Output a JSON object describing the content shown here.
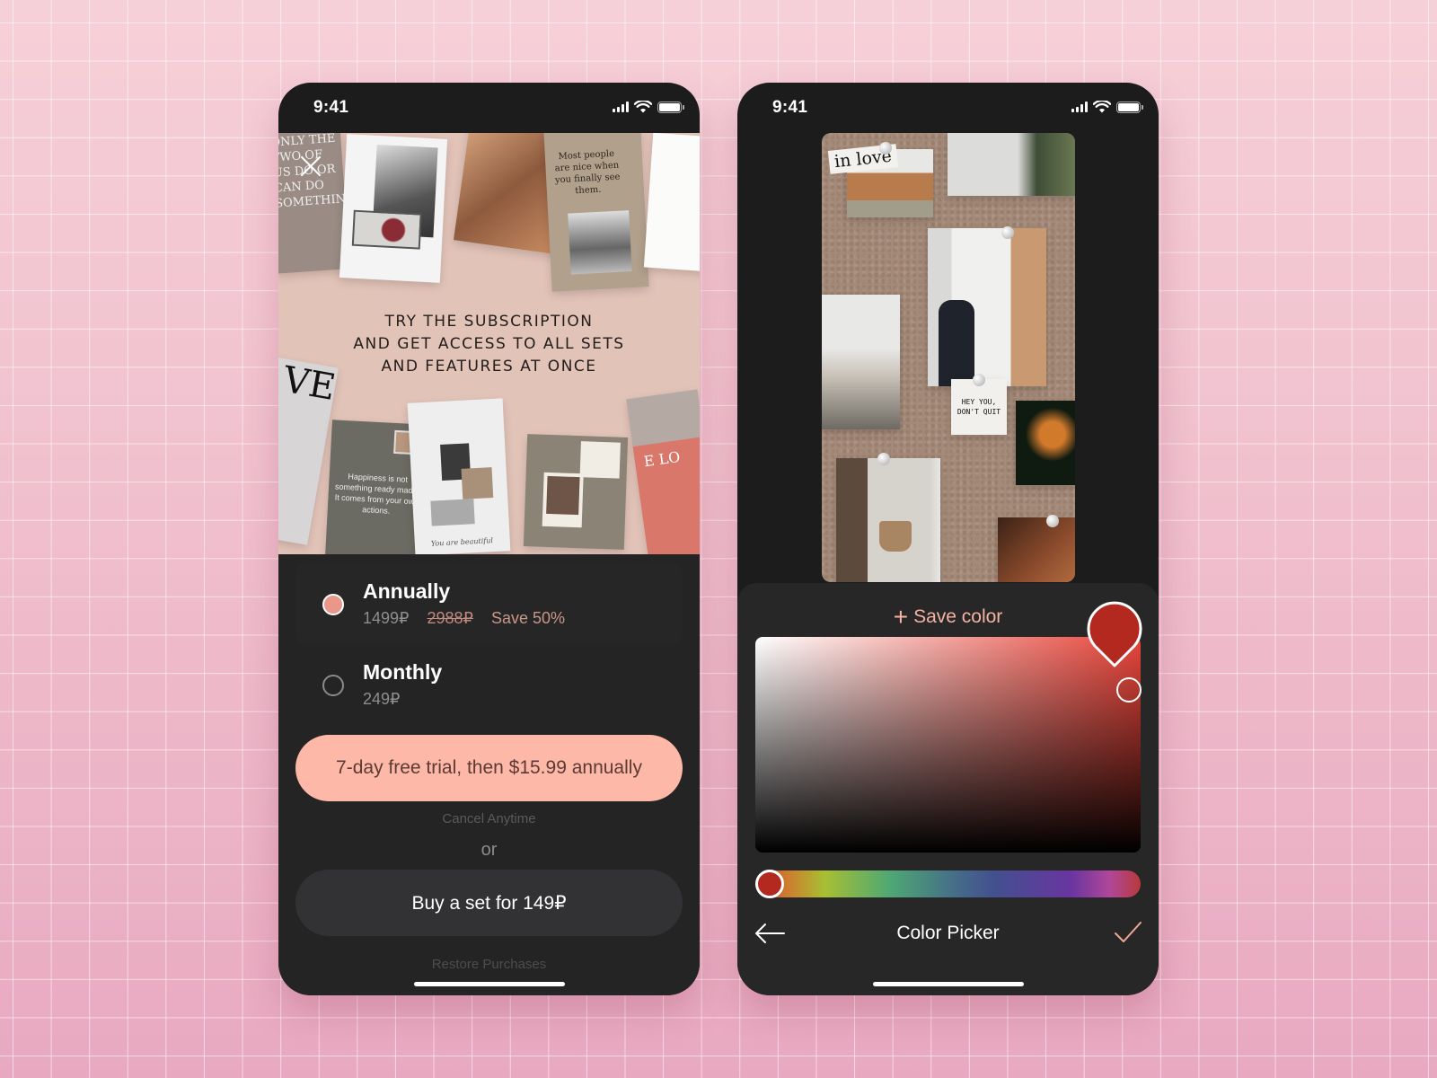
{
  "status_bar": {
    "time": "9:41"
  },
  "paywall": {
    "hero_lines": [
      "TRY THE SUBSCRIPTION",
      "AND GET ACCESS TO ALL SETS",
      "AND FEATURES AT ONCE"
    ],
    "hero_cards": {
      "quote_top_left": "ONLY THE TWO OF US DO OR CAN DO SOMETHING",
      "quote_top_right": "Most people are nice when you finally see them.",
      "quote_bottom": "Happiness is not something ready made. It comes from your own actions.",
      "script_caption": "You are beautiful",
      "big_letters_left": "VE",
      "big_letters_right": "E LO"
    },
    "plans": [
      {
        "name": "Annually",
        "price": "1499₽",
        "old_price": "2988₽",
        "save": "Save 50%",
        "selected": true
      },
      {
        "name": "Monthly",
        "price": "249₽",
        "selected": false
      }
    ],
    "cta_label": "7-day free trial, then $15.99 annually",
    "cancel_note": "Cancel Anytime",
    "or_label": "or",
    "buy_set_label": "Buy a set for 149₽",
    "restore_label": "Restore Purchases"
  },
  "color_picker": {
    "moodboard": {
      "sticker_text": "in love",
      "note_text": "HEY YOU, DON'T QUIT"
    },
    "save_color_label": "Save color",
    "title": "Color Picker",
    "selected_color": "#b3291f",
    "hue_color": "#e8453a",
    "hue_position": 0.0,
    "saturation": 0.97,
    "brightness": 0.82
  },
  "colors": {
    "accent_peach": "#fdb8a8",
    "accent_text": "#f4b3a3",
    "selected_radio": "#e9978a"
  }
}
